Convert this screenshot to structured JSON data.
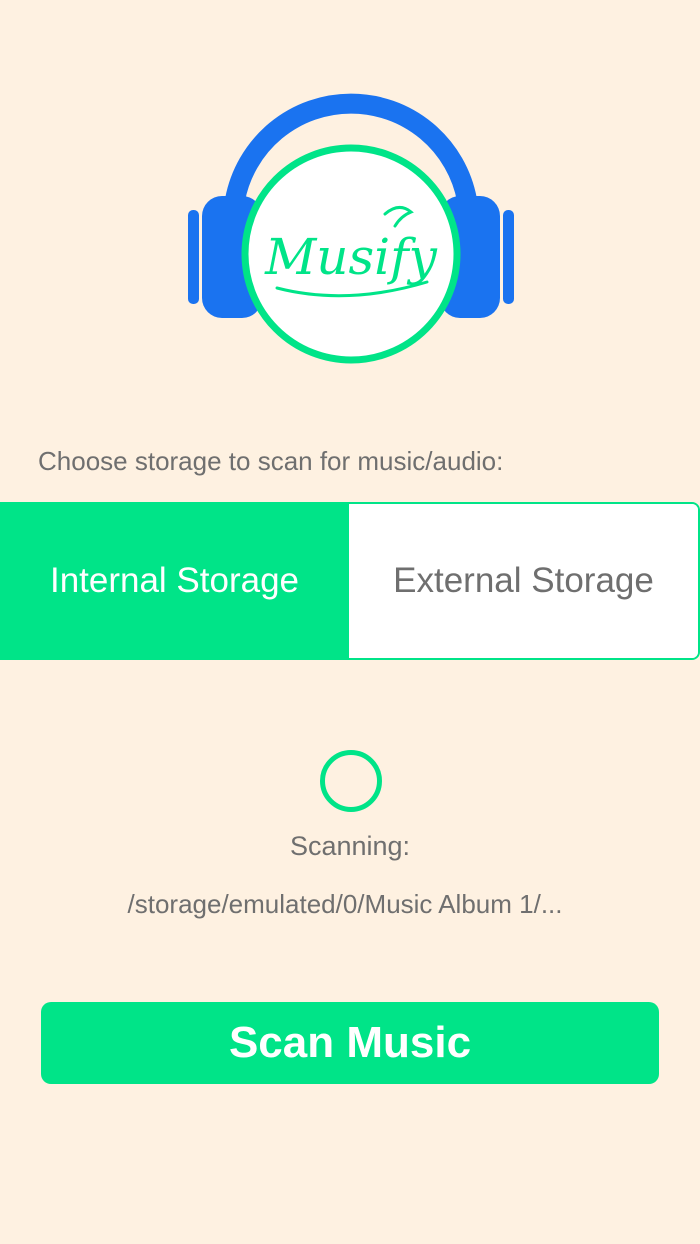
{
  "app": {
    "logo_text": "Musify",
    "colors": {
      "background": "#FEF1E1",
      "accent": "#00E488",
      "headphone_blue": "#1A73F0",
      "text_gray": "#6F6F6F"
    }
  },
  "storage": {
    "prompt": "Choose storage to scan for music/audio:",
    "options": [
      {
        "label": "Internal Storage",
        "selected": true
      },
      {
        "label": "External Storage",
        "selected": false
      }
    ]
  },
  "scan": {
    "status_label": "Scanning:",
    "current_path": "/storage/emulated/0/Music Album 1/...",
    "button_label": "Scan Music"
  }
}
